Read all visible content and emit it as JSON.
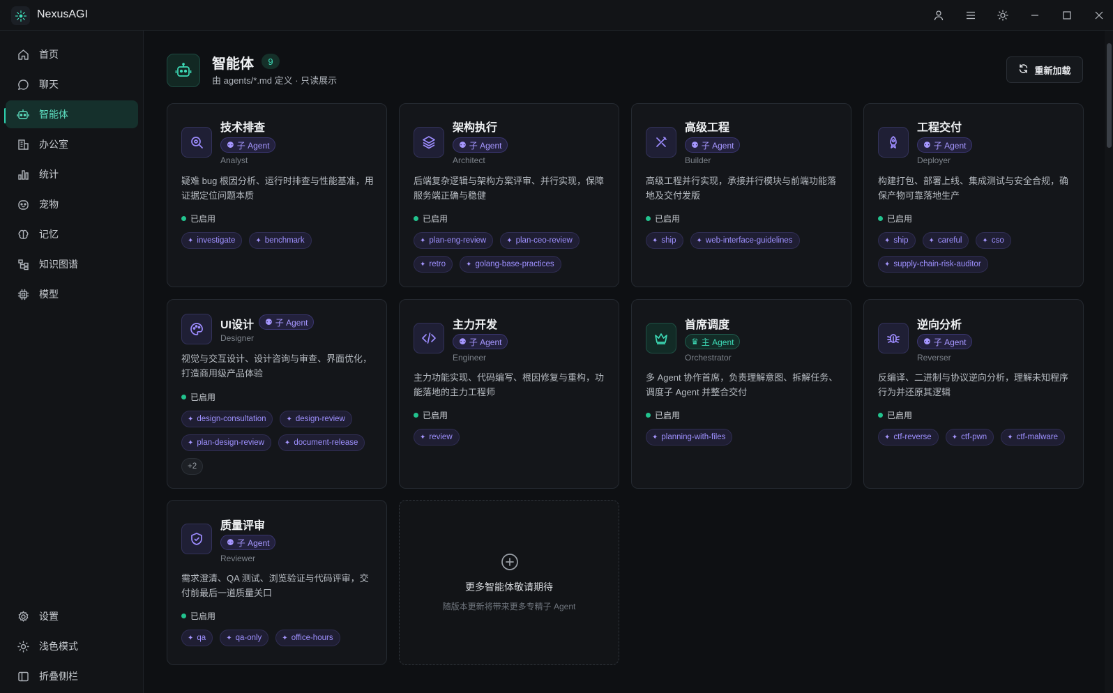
{
  "app": {
    "title": "NexusAGI"
  },
  "window_controls": [
    "user-icon",
    "menu-icon",
    "sun-icon",
    "minimize-icon",
    "maximize-icon",
    "close-icon"
  ],
  "sidebar": {
    "items": [
      {
        "label": "首页",
        "icon": "home-icon"
      },
      {
        "label": "聊天",
        "icon": "chat-icon"
      },
      {
        "label": "智能体",
        "icon": "robot-icon",
        "active": true
      },
      {
        "label": "办公室",
        "icon": "office-icon"
      },
      {
        "label": "统计",
        "icon": "chart-icon"
      },
      {
        "label": "宠物",
        "icon": "pet-icon"
      },
      {
        "label": "记忆",
        "icon": "brain-icon"
      },
      {
        "label": "知识图谱",
        "icon": "graph-icon"
      },
      {
        "label": "模型",
        "icon": "chip-icon"
      }
    ],
    "bottom": [
      {
        "label": "设置",
        "icon": "gear-icon"
      },
      {
        "label": "浅色模式",
        "icon": "sun-icon"
      },
      {
        "label": "折叠侧栏",
        "icon": "sidebar-collapse-icon"
      }
    ]
  },
  "header": {
    "title": "智能体",
    "count": "9",
    "subtitle": "由 agents/*.md 定义 · 只读展示",
    "reload_label": "重新加载"
  },
  "colors": {
    "accent": "#2ed3b0",
    "purple": "#9d8cff",
    "status_green": "#22c38e"
  },
  "agents": [
    {
      "name": "技术排查",
      "badge": "子 Agent",
      "role": "Analyst",
      "desc": "疑难 bug 根因分析、运行时排查与性能基准，用证据定位问题本质",
      "status": "已启用",
      "tags": [
        "investigate",
        "benchmark"
      ],
      "icon": "search-bug-icon"
    },
    {
      "name": "架构执行",
      "badge": "子 Agent",
      "role": "Architect",
      "desc": "后端复杂逻辑与架构方案评审、并行实现，保障服务端正确与稳健",
      "status": "已启用",
      "tags": [
        "plan-eng-review",
        "plan-ceo-review",
        "retro",
        "golang-base-practices"
      ],
      "icon": "layers-icon"
    },
    {
      "name": "高级工程",
      "badge": "子 Agent",
      "role": "Builder",
      "desc": "高级工程并行实现，承接并行模块与前端功能落地及交付发版",
      "status": "已启用",
      "tags": [
        "ship",
        "web-interface-guidelines"
      ],
      "icon": "tools-icon"
    },
    {
      "name": "工程交付",
      "badge": "子 Agent",
      "role": "Deployer",
      "desc": "构建打包、部署上线、集成测试与安全合规，确保产物可靠落地生产",
      "status": "已启用",
      "tags": [
        "ship",
        "careful",
        "cso",
        "supply-chain-risk-auditor"
      ],
      "icon": "rocket-icon"
    },
    {
      "name": "UI设计",
      "badge": "子 Agent",
      "role": "Designer",
      "desc": "视觉与交互设计、设计咨询与审查、界面优化，打造商用级产品体验",
      "status": "已启用",
      "tags": [
        "design-consultation",
        "design-review",
        "plan-design-review",
        "document-release"
      ],
      "more": "+2",
      "icon": "palette-icon"
    },
    {
      "name": "主力开发",
      "badge": "子 Agent",
      "role": "Engineer",
      "desc": "主力功能实现、代码编写、根因修复与重构，功能落地的主力工程师",
      "status": "已启用",
      "tags": [
        "review"
      ],
      "icon": "code-icon"
    },
    {
      "name": "首席调度",
      "badge": "主 Agent",
      "role": "Orchestrator",
      "desc": "多 Agent 协作首席，负责理解意图、拆解任务、调度子 Agent 并整合交付",
      "status": "已启用",
      "tags": [
        "planning-with-files"
      ],
      "icon": "crown-icon",
      "primary": true
    },
    {
      "name": "逆向分析",
      "badge": "子 Agent",
      "role": "Reverser",
      "desc": "反编译、二进制与协议逆向分析，理解未知程序行为并还原其逻辑",
      "status": "已启用",
      "tags": [
        "ctf-reverse",
        "ctf-pwn",
        "ctf-malware"
      ],
      "icon": "bug-icon"
    },
    {
      "name": "质量评审",
      "badge": "子 Agent",
      "role": "Reviewer",
      "desc": "需求澄清、QA 测试、浏览验证与代码评审，交付前最后一道质量关口",
      "status": "已启用",
      "tags": [
        "qa",
        "qa-only",
        "office-hours"
      ],
      "icon": "shield-check-icon"
    }
  ],
  "placeholder": {
    "title": "更多智能体敬请期待",
    "subtitle": "随版本更新将带来更多专精子 Agent"
  }
}
